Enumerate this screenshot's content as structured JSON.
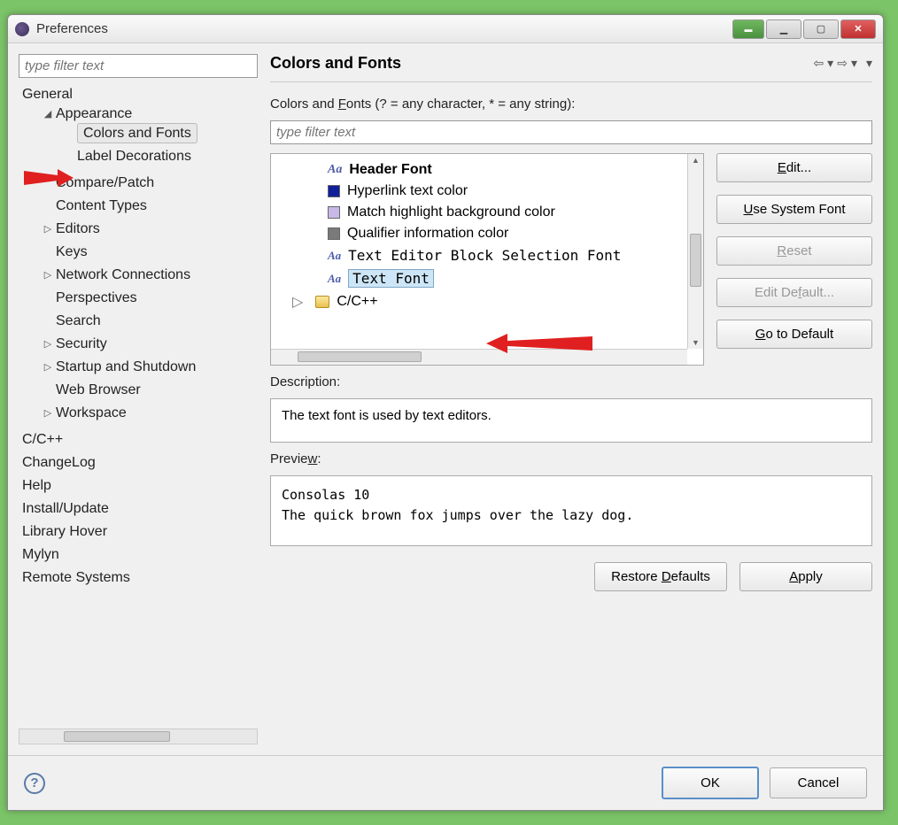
{
  "window": {
    "title": "Preferences"
  },
  "sidebar": {
    "filter_placeholder": "type filter text",
    "items": {
      "general": "General",
      "appearance": "Appearance",
      "colors_fonts": "Colors and Fonts",
      "label_decorations": "Label Decorations",
      "compare_patch": "Compare/Patch",
      "content_types": "Content Types",
      "editors": "Editors",
      "keys": "Keys",
      "network": "Network Connections",
      "perspectives": "Perspectives",
      "search": "Search",
      "security": "Security",
      "startup": "Startup and Shutdown",
      "web_browser": "Web Browser",
      "workspace": "Workspace",
      "ccpp": "C/C++",
      "changelog": "ChangeLog",
      "help": "Help",
      "install": "Install/Update",
      "libhover": "Library Hover",
      "mylyn": "Mylyn",
      "remote": "Remote Systems"
    }
  },
  "main": {
    "title": "Colors and Fonts",
    "filter_label": "Colors and Fonts (? = any character, * = any string):",
    "filter_placeholder": "type filter text",
    "tree": {
      "header_font": "Header Font",
      "hyperlink": "Hyperlink text color",
      "match_hl": "Match highlight background color",
      "qualifier": "Qualifier information color",
      "block_sel": "Text Editor Block Selection Font",
      "text_font": "Text Font",
      "ccpp": "C/C++"
    },
    "swatch_colors": {
      "hyperlink": "#10209a",
      "match_hl": "#c8b8e8",
      "qualifier": "#7a7a7a"
    },
    "buttons": {
      "edit": "Edit...",
      "system_font": "Use System Font",
      "reset": "Reset",
      "edit_default": "Edit Default...",
      "go_default": "Go to Default"
    },
    "description_label": "Description:",
    "description_text": "The text font is used by text editors.",
    "preview_label": "Preview:",
    "preview_line1": "Consolas 10",
    "preview_line2": "The quick brown fox jumps over the lazy dog.",
    "restore_defaults": "Restore Defaults",
    "apply": "Apply"
  },
  "footer": {
    "ok": "OK",
    "cancel": "Cancel"
  }
}
